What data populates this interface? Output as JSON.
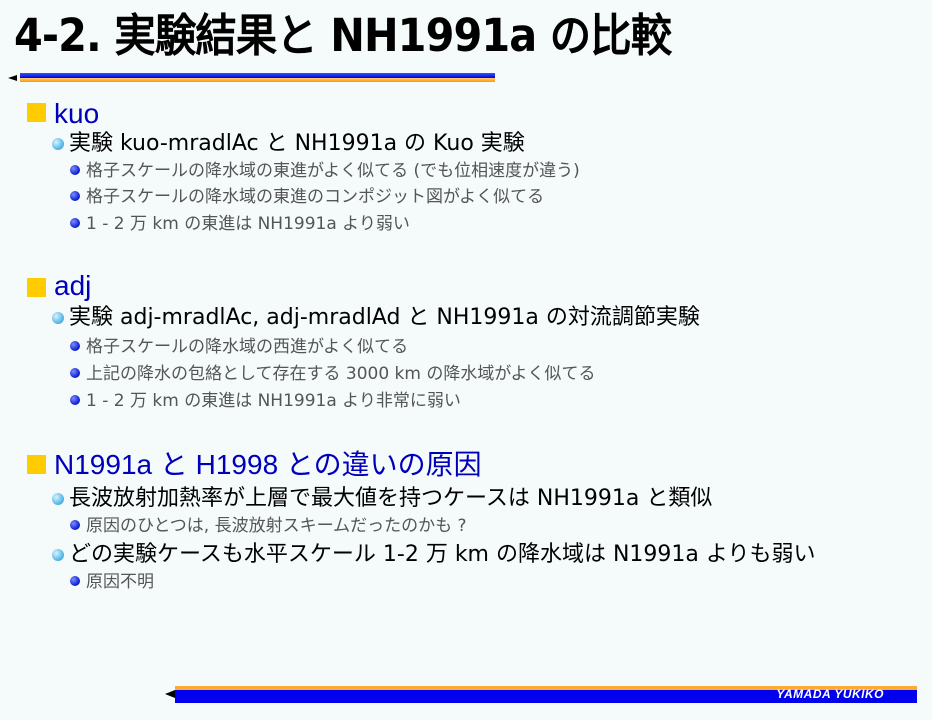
{
  "title": "4-2. 実験結果と NH1991a の比較",
  "footer": "YAMADA YUKIKO",
  "sections": [
    {
      "heading": "kuo",
      "items": [
        {
          "text": "実験 kuo-mradlAc と NH1991a の Kuo 実験",
          "sub": [
            "格子スケールの降水域の東進がよく似てる (でも位相速度が違う)",
            "格子スケールの降水域の東進のコンポジット図がよく似てる",
            "1 - 2 万 km の東進は NH1991a より弱い"
          ]
        }
      ]
    },
    {
      "heading": "adj",
      "items": [
        {
          "text": "実験 adj-mradlAc, adj-mradlAd と NH1991a の対流調節実験",
          "sub": [
            "格子スケールの降水域の西進がよく似てる",
            "上記の降水の包絡として存在する 3000 km の降水域がよく似てる",
            "1 - 2 万 km の東進は NH1991a より非常に弱い"
          ]
        }
      ]
    },
    {
      "heading": "N1991a と H1998 との違いの原因",
      "items": [
        {
          "text": "長波放射加熱率が上層で最大値を持つケースは NH1991a と類似",
          "sub": [
            "原因のひとつは, 長波放射スキームだったのかも ?"
          ]
        },
        {
          "text": "どの実験ケースも水平スケール 1-2 万 km の降水域は N1991a よりも弱い",
          "sub": [
            "原因不明"
          ]
        }
      ]
    }
  ]
}
